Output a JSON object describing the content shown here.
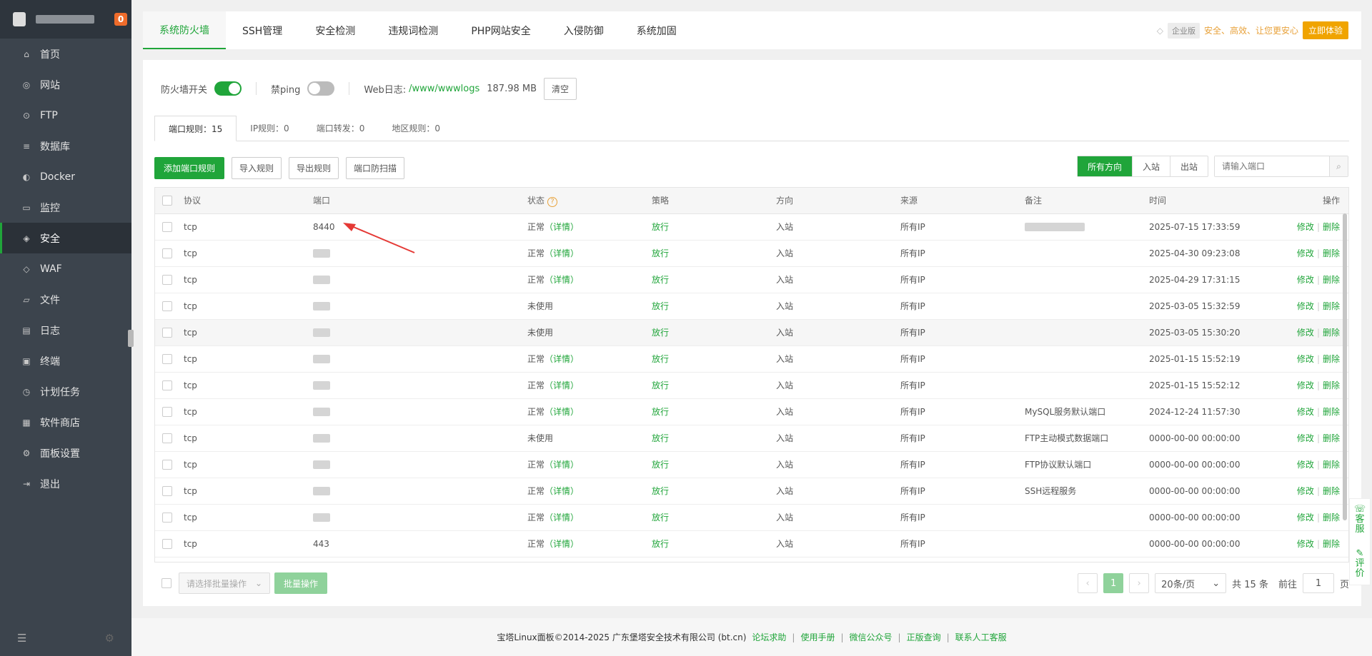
{
  "sidebar": {
    "badge": "0",
    "items": [
      {
        "label": "首页",
        "icon": "home-icon",
        "glyph": "⌂"
      },
      {
        "label": "网站",
        "icon": "globe-icon",
        "glyph": "◎"
      },
      {
        "label": "FTP",
        "icon": "ftp-icon",
        "glyph": "⊙"
      },
      {
        "label": "数据库",
        "icon": "database-icon",
        "glyph": "≡"
      },
      {
        "label": "Docker",
        "icon": "docker-icon",
        "glyph": "◐"
      },
      {
        "label": "监控",
        "icon": "monitor-icon",
        "glyph": "▭"
      },
      {
        "label": "安全",
        "icon": "shield-icon",
        "glyph": "◈"
      },
      {
        "label": "WAF",
        "icon": "waf-icon",
        "glyph": "◇"
      },
      {
        "label": "文件",
        "icon": "folder-icon",
        "glyph": "▱"
      },
      {
        "label": "日志",
        "icon": "log-icon",
        "glyph": "▤"
      },
      {
        "label": "终端",
        "icon": "terminal-icon",
        "glyph": "▣"
      },
      {
        "label": "计划任务",
        "icon": "clock-icon",
        "glyph": "◷"
      },
      {
        "label": "软件商店",
        "icon": "store-icon",
        "glyph": "▦"
      },
      {
        "label": "面板设置",
        "icon": "gear-icon",
        "glyph": "⚙"
      },
      {
        "label": "退出",
        "icon": "logout-icon",
        "glyph": "⇥"
      }
    ],
    "active_index": 6
  },
  "tabs": [
    "系统防火墙",
    "SSH管理",
    "安全检测",
    "违规词检测",
    "PHP网站安全",
    "入侵防御",
    "系统加固"
  ],
  "promo": {
    "tag": "企业版",
    "text": "安全、高效、让您更安心",
    "button": "立即体验"
  },
  "toolbar": {
    "firewall_label": "防火墙开关",
    "ping_label": "禁ping",
    "weblog_label": "Web日志:",
    "weblog_path": "/www/wwwlogs",
    "weblog_size": "187.98 MB",
    "clear_button": "清空"
  },
  "subtabs": [
    "端口规则：15",
    "IP规则：0",
    "端口转发：0",
    "地区规则：0"
  ],
  "actions": [
    "添加端口规则",
    "导入规则",
    "导出规则",
    "端口防扫描"
  ],
  "directions": [
    "所有方向",
    "入站",
    "出站"
  ],
  "search": {
    "placeholder": "请输入端口"
  },
  "table": {
    "headers": [
      "协议",
      "端口",
      "状态",
      "策略",
      "方向",
      "来源",
      "备注",
      "时间",
      "操作"
    ],
    "detail_text": "（详情）",
    "edit_text": "修改",
    "delete_text": "删除",
    "rows": [
      {
        "proto": "tcp",
        "port": "8440",
        "status": "正常",
        "detail": true,
        "policy": "放行",
        "dir": "入站",
        "src": "所有IP",
        "note": "",
        "note_blur": true,
        "time": "2025-07-15 17:33:59"
      },
      {
        "proto": "tcp",
        "port": "",
        "status": "正常",
        "detail": true,
        "policy": "放行",
        "dir": "入站",
        "src": "所有IP",
        "note": "",
        "time": "2025-04-30 09:23:08"
      },
      {
        "proto": "tcp",
        "port": "",
        "status": "正常",
        "detail": true,
        "policy": "放行",
        "dir": "入站",
        "src": "所有IP",
        "note": "",
        "time": "2025-04-29 17:31:15"
      },
      {
        "proto": "tcp",
        "port": "",
        "status": "未使用",
        "detail": false,
        "policy": "放行",
        "dir": "入站",
        "src": "所有IP",
        "note": "",
        "time": "2025-03-05 15:32:59"
      },
      {
        "proto": "tcp",
        "port": "",
        "status": "未使用",
        "detail": false,
        "policy": "放行",
        "dir": "入站",
        "src": "所有IP",
        "note": "",
        "time": "2025-03-05 15:30:20"
      },
      {
        "proto": "tcp",
        "port": "",
        "status": "正常",
        "detail": true,
        "policy": "放行",
        "dir": "入站",
        "src": "所有IP",
        "note": "",
        "time": "2025-01-15 15:52:19"
      },
      {
        "proto": "tcp",
        "port": "",
        "status": "正常",
        "detail": true,
        "policy": "放行",
        "dir": "入站",
        "src": "所有IP",
        "note": "",
        "time": "2025-01-15 15:52:12"
      },
      {
        "proto": "tcp",
        "port": "",
        "status": "正常",
        "detail": true,
        "policy": "放行",
        "dir": "入站",
        "src": "所有IP",
        "note": "MySQL服务默认端口",
        "time": "2024-12-24 11:57:30"
      },
      {
        "proto": "tcp",
        "port": "",
        "status": "未使用",
        "detail": false,
        "policy": "放行",
        "dir": "入站",
        "src": "所有IP",
        "note": "FTP主动模式数据端口",
        "time": "0000-00-00 00:00:00"
      },
      {
        "proto": "tcp",
        "port": "",
        "status": "正常",
        "detail": true,
        "policy": "放行",
        "dir": "入站",
        "src": "所有IP",
        "note": "FTP协议默认端口",
        "time": "0000-00-00 00:00:00"
      },
      {
        "proto": "tcp",
        "port": "",
        "status": "正常",
        "detail": true,
        "policy": "放行",
        "dir": "入站",
        "src": "所有IP",
        "note": "SSH远程服务",
        "time": "0000-00-00 00:00:00"
      },
      {
        "proto": "tcp",
        "port": "",
        "status": "正常",
        "detail": true,
        "policy": "放行",
        "dir": "入站",
        "src": "所有IP",
        "note": "",
        "time": "0000-00-00 00:00:00"
      },
      {
        "proto": "tcp",
        "port": "443",
        "status": "正常",
        "detail": true,
        "policy": "放行",
        "dir": "入站",
        "src": "所有IP",
        "note": "",
        "time": "0000-00-00 00:00:00"
      }
    ]
  },
  "footer": {
    "batch_placeholder": "请选择批量操作",
    "batch_button": "批量操作",
    "current_page": "1",
    "page_size": "20条/页",
    "total": "共 15 条",
    "goto_prefix": "前往",
    "goto_value": "1",
    "goto_suffix": "页"
  },
  "copyright": {
    "text": "宝塔Linux面板©2014-2025 广东堡塔安全技术有限公司 (bt.cn)",
    "links": [
      "论坛求助",
      "使用手册",
      "微信公众号",
      "正版查询",
      "联系人工客服"
    ]
  },
  "float": {
    "service": "客服",
    "review": "评价"
  }
}
